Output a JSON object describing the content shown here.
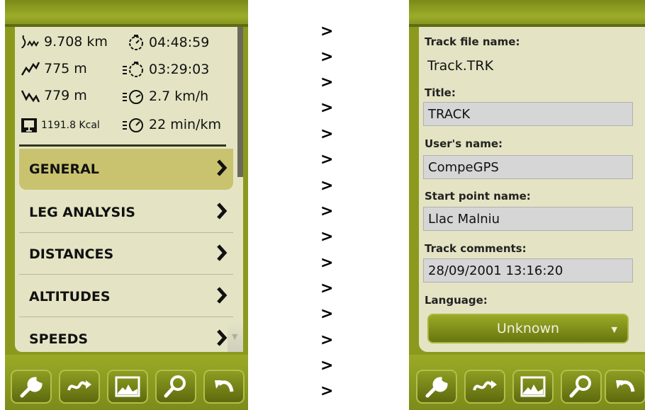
{
  "left": {
    "stats": [
      {
        "icon": "distance-icon",
        "value": "9.708 km"
      },
      {
        "icon": "stopwatch-icon",
        "value": "04:48:59"
      },
      {
        "icon": "ascent-icon",
        "value": "775 m"
      },
      {
        "icon": "moving-time-icon",
        "value": "03:29:03"
      },
      {
        "icon": "descent-icon",
        "value": "779 m"
      },
      {
        "icon": "speed-icon",
        "value": "2.7 km/h"
      },
      {
        "icon": "calories-icon",
        "value": "1191.8 Kcal"
      },
      {
        "icon": "pace-icon",
        "value": "22 min/km"
      }
    ],
    "menu": [
      {
        "label": "GENERAL",
        "active": true
      },
      {
        "label": "LEG ANALYSIS",
        "active": false
      },
      {
        "label": "DISTANCES",
        "active": false
      },
      {
        "label": "ALTITUDES",
        "active": false
      },
      {
        "label": "SPEEDS",
        "active": false
      }
    ]
  },
  "arrows": [
    ">",
    ">",
    ">",
    ">",
    ">",
    ">",
    ">",
    ">",
    ">",
    ">",
    ">",
    ">",
    ">",
    ">",
    ">"
  ],
  "right": {
    "track_file_name_label": "Track file name:",
    "track_file_name": "Track.TRK",
    "title_label": "Title:",
    "title_value": "TRACK",
    "users_name_label": "User's name:",
    "users_name_value": "CompeGPS",
    "start_point_label": "Start point name:",
    "start_point_value": "Llac Malniu",
    "comments_label": "Track comments:",
    "comments_value": "28/09/2001 13:16:20",
    "language_label": "Language:",
    "language_value": "Unknown"
  },
  "toolbar": [
    "settings-wrench-icon",
    "track-icon",
    "profile-chart-icon",
    "search-icon",
    "back-icon"
  ],
  "colors": {
    "bar_green": "#8b9a1e",
    "content_bg": "#e4e4c4",
    "active_item": "#c9c370"
  }
}
